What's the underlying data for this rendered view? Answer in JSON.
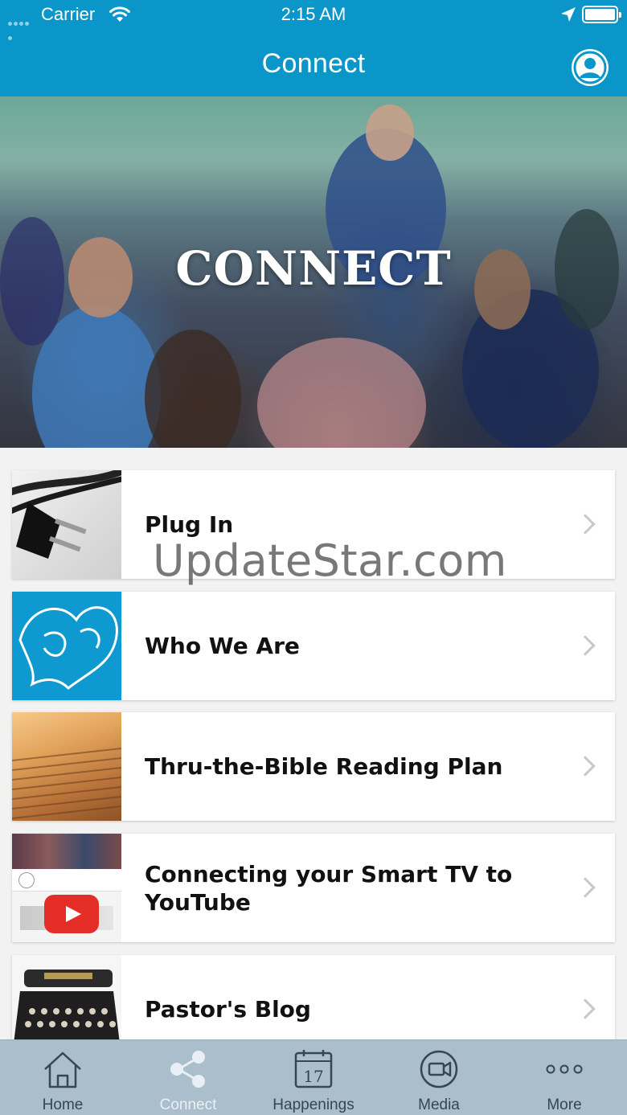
{
  "status_bar": {
    "carrier": "Carrier",
    "time": "2:15 AM"
  },
  "nav": {
    "title": "Connect"
  },
  "hero": {
    "title": "CONNECT"
  },
  "list": {
    "items": [
      {
        "label": "Plug In"
      },
      {
        "label": "Who We Are"
      },
      {
        "label": "Thru-the-Bible Reading Plan"
      },
      {
        "label": "Connecting your Smart TV to YouTube"
      },
      {
        "label": "Pastor's Blog"
      }
    ]
  },
  "watermark": "UpdateStar.com",
  "tabs": [
    {
      "label": "Home",
      "icon": "home-icon"
    },
    {
      "label": "Connect",
      "icon": "share-icon",
      "active": true
    },
    {
      "label": "Happenings",
      "icon": "calendar-icon"
    },
    {
      "label": "Media",
      "icon": "video-icon"
    },
    {
      "label": "More",
      "icon": "more-icon"
    }
  ],
  "colors": {
    "accent": "#0a96c9",
    "tabbar": "#aabecb",
    "who_we_are_tile": "#0e9ad0"
  }
}
